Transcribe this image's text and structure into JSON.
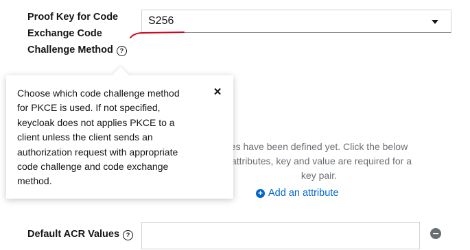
{
  "pkce": {
    "label_lines": [
      "Proof Key for Code",
      "Exchange Code",
      "Challenge Method"
    ],
    "help_glyph": "?",
    "selected_value": "S256"
  },
  "popover": {
    "text": "Choose which code challenge method for PKCE is used. If not specified, keycloak does not applies PKCE to a client unless the client sends an authorization request with appropriate code challenge and code exchange method.",
    "close_glyph": "×"
  },
  "attributes": {
    "empty_lines": [
      "es have been defined yet. Click the below",
      "l attributes, key and value are required for a",
      "key pair."
    ],
    "add_label": "Add an attribute",
    "add_glyph": "+"
  },
  "acr": {
    "label": "Default ACR Values",
    "help_glyph": "?",
    "value": ""
  },
  "colors": {
    "link": "#0066cc",
    "annotation": "#d0021b",
    "muted_text": "#6a6e73"
  }
}
